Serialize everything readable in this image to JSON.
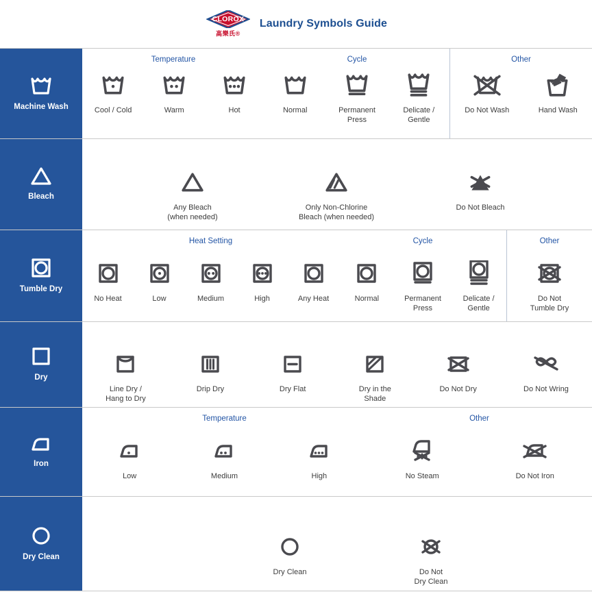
{
  "header": {
    "brand": "CLOROX",
    "brand_cn": "高樂氏®",
    "title": "Laundry Symbols Guide",
    "brand_color": "#c8102e",
    "title_color": "#1d4f91"
  },
  "theme": {
    "category_bg": "#25559b",
    "group_title_color": "#2355a5",
    "icon_color": "#4a4a4f",
    "label_color": "#3c3c3c"
  },
  "rows": [
    {
      "category": "Machine Wash",
      "category_icon": "wash-tub-icon",
      "groups": [
        {
          "title": "Temperature",
          "items": [
            {
              "label": "Cool  / Cold",
              "icon": "wash-tub-one-dot-icon"
            },
            {
              "label": "Warm",
              "icon": "wash-tub-two-dots-icon"
            },
            {
              "label": "Hot",
              "icon": "wash-tub-three-dots-icon"
            }
          ]
        },
        {
          "title": "Cycle",
          "items": [
            {
              "label": "Normal",
              "icon": "wash-tub-icon"
            },
            {
              "label": "Permanent\nPress",
              "icon": "wash-tub-one-bar-icon"
            },
            {
              "label": "Delicate /\nGentle",
              "icon": "wash-tub-two-bars-icon"
            }
          ]
        },
        {
          "title": "Other",
          "items": [
            {
              "label": "Do Not Wash",
              "icon": "wash-tub-crossed-icon"
            },
            {
              "label": "Hand Wash",
              "icon": "hand-wash-icon"
            }
          ]
        }
      ]
    },
    {
      "category": "Bleach",
      "category_icon": "triangle-icon",
      "groups": [
        {
          "title": "",
          "items": [
            {
              "label": "Any Bleach\n(when needed)",
              "icon": "triangle-icon"
            },
            {
              "label": "Only Non-Chlorine\nBleach (when needed)",
              "icon": "triangle-striped-icon"
            },
            {
              "label": "Do Not Bleach",
              "icon": "triangle-filled-crossed-icon"
            }
          ]
        }
      ]
    },
    {
      "category": "Tumble Dry",
      "category_icon": "tumble-dry-icon",
      "groups": [
        {
          "title": "Heat Setting",
          "items": [
            {
              "label": "No Heat",
              "icon": "tumble-dry-icon"
            },
            {
              "label": "Low",
              "icon": "tumble-dry-one-dot-icon"
            },
            {
              "label": "Medium",
              "icon": "tumble-dry-two-dots-icon"
            },
            {
              "label": "High",
              "icon": "tumble-dry-three-dots-icon"
            },
            {
              "label": "Any Heat",
              "icon": "tumble-dry-icon"
            }
          ]
        },
        {
          "title": "Cycle",
          "items": [
            {
              "label": "Normal",
              "icon": "tumble-dry-icon"
            },
            {
              "label": "Permanent\nPress",
              "icon": "tumble-dry-one-bar-icon"
            },
            {
              "label": "Delicate /\nGentle",
              "icon": "tumble-dry-two-bars-icon"
            }
          ]
        },
        {
          "title": "Other",
          "items": [
            {
              "label": "Do Not\nTumble Dry",
              "icon": "tumble-dry-crossed-icon"
            }
          ]
        }
      ]
    },
    {
      "category": "Dry",
      "category_icon": "square-icon",
      "groups": [
        {
          "title": "",
          "items": [
            {
              "label": "Line Dry /\nHang to Dry",
              "icon": "line-dry-icon"
            },
            {
              "label": "Drip Dry",
              "icon": "drip-dry-icon"
            },
            {
              "label": "Dry Flat",
              "icon": "dry-flat-icon"
            },
            {
              "label": "Dry in the\nShade",
              "icon": "dry-shade-icon"
            },
            {
              "label": "Do Not Dry",
              "icon": "do-not-dry-icon"
            },
            {
              "label": "Do Not Wring",
              "icon": "do-not-wring-icon"
            }
          ]
        }
      ]
    },
    {
      "category": "Iron",
      "category_icon": "iron-icon",
      "groups": [
        {
          "title": "Temperature",
          "items": [
            {
              "label": "Low",
              "icon": "iron-one-dot-icon"
            },
            {
              "label": "Medium",
              "icon": "iron-two-dots-icon"
            },
            {
              "label": "High",
              "icon": "iron-three-dots-icon"
            }
          ]
        },
        {
          "title": "Other",
          "items": [
            {
              "label": "No Steam",
              "icon": "iron-no-steam-icon"
            },
            {
              "label": "Do Not Iron",
              "icon": "iron-crossed-icon"
            }
          ]
        }
      ]
    },
    {
      "category": "Dry Clean",
      "category_icon": "circle-icon",
      "groups": [
        {
          "title": "",
          "items": [
            {
              "label": "Dry Clean",
              "icon": "circle-icon"
            },
            {
              "label": "Do Not\nDry Clean",
              "icon": "circle-crossed-icon"
            }
          ]
        }
      ]
    }
  ]
}
